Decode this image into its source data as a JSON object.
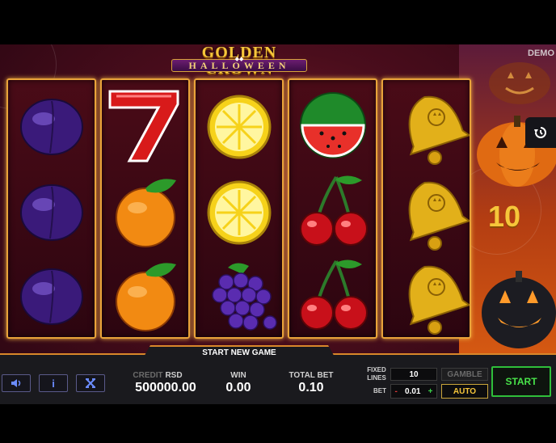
{
  "game": {
    "title_top": "GOLDEN CROWN",
    "title_bottom": "HALLOWEEN",
    "mode_label": "DEMO",
    "lines_number": "10",
    "reels": [
      [
        "plum",
        "plum",
        "plum"
      ],
      [
        "seven",
        "orange",
        "orange"
      ],
      [
        "lemon",
        "lemon",
        "grapes"
      ],
      [
        "watermelon",
        "cherries",
        "cherries"
      ],
      [
        "bell",
        "bell",
        "bell"
      ]
    ],
    "start_new_game": "START NEW GAME"
  },
  "controls": {
    "sound_icon": "speaker-icon",
    "info_icon": "info-icon",
    "fullscreen_icon": "fullscreen-icon",
    "history_icon": "history-icon",
    "credit_label": "CREDIT",
    "currency": "RSD",
    "credit_value": "500000.00",
    "win_label": "WIN",
    "win_value": "0.00",
    "total_bet_label": "TOTAL BET",
    "total_bet_value": "0.10",
    "fixed_lines_label": "FIXED LINES",
    "fixed_lines_value": "10",
    "bet_label": "BET",
    "bet_minus": "-",
    "bet_value": "0.01",
    "bet_plus": "+",
    "gamble_label": "GAMBLE",
    "auto_label": "AUTO",
    "start_label": "START"
  },
  "colors": {
    "reel_border": "#e9a33a",
    "start_green": "#48e34a",
    "gold": "#f6c63a"
  }
}
